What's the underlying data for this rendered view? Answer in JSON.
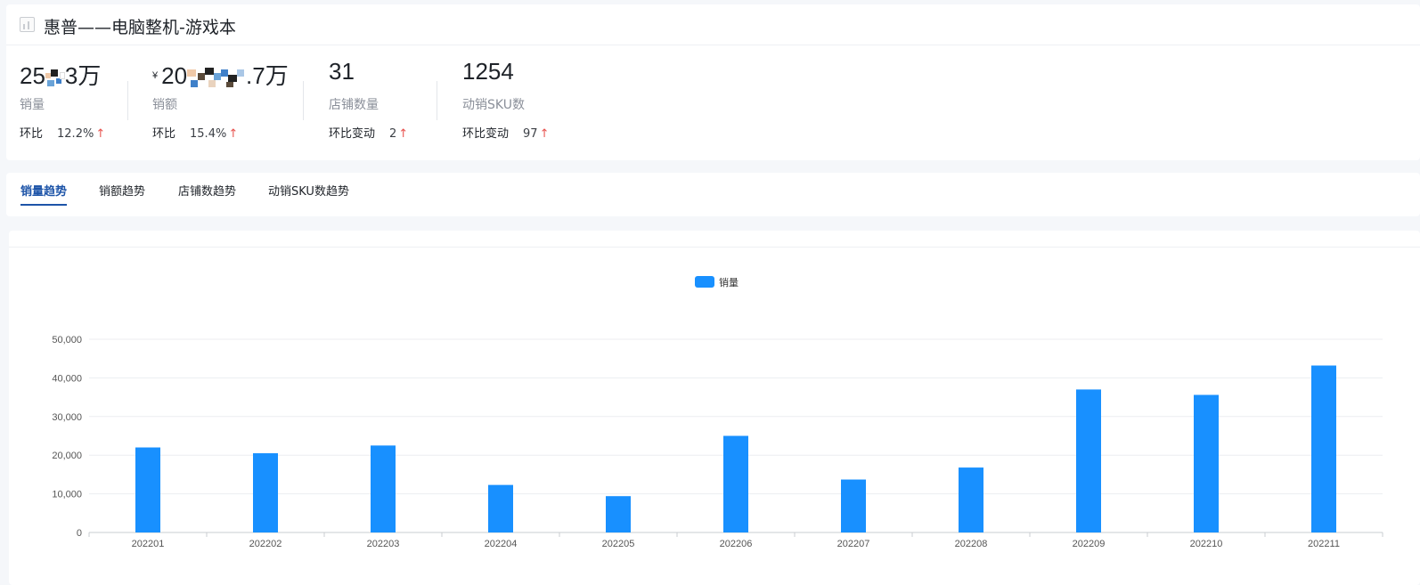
{
  "title": "惠普——电脑整机-游戏本",
  "metrics": [
    {
      "value_prefix": "25",
      "value_suffix": "3万",
      "label": "销量",
      "change_label": "环比",
      "change_value": "12.2%",
      "trend": "↑"
    },
    {
      "yen": "¥",
      "value_prefix": "20",
      "value_suffix": ".7万",
      "label": "销额",
      "change_label": "环比",
      "change_value": "15.4%",
      "trend": "↑"
    },
    {
      "value": "31",
      "label": "店铺数量",
      "change_label": "环比变动",
      "change_value": "2",
      "trend": "↑"
    },
    {
      "value": "1254",
      "label": "动销SKU数",
      "change_label": "环比变动",
      "change_value": "97",
      "trend": "↑"
    }
  ],
  "tabs": [
    {
      "label": "销量趋势",
      "active": true
    },
    {
      "label": "销额趋势",
      "active": false
    },
    {
      "label": "店铺数趋势",
      "active": false
    },
    {
      "label": "动销SKU数趋势",
      "active": false
    }
  ],
  "chart_data": {
    "type": "bar",
    "categories": [
      "202201",
      "202202",
      "202203",
      "202204",
      "202205",
      "202206",
      "202207",
      "202208",
      "202209",
      "202210",
      "202211"
    ],
    "series": [
      {
        "name": "销量",
        "values": [
          22000,
          20500,
          22500,
          12300,
          9400,
          25000,
          13700,
          16800,
          37000,
          35600,
          43200
        ],
        "color": "#1890ff"
      }
    ],
    "yticks": [
      "0",
      "10,000",
      "20,000",
      "30,000",
      "40,000",
      "50,000"
    ],
    "ylim": [
      0,
      50000
    ],
    "grid": true,
    "legend": "top-center"
  },
  "colors": {
    "accent": "#1d54a8",
    "bar": "#1890ff",
    "up_arrow": "#e8534f"
  }
}
